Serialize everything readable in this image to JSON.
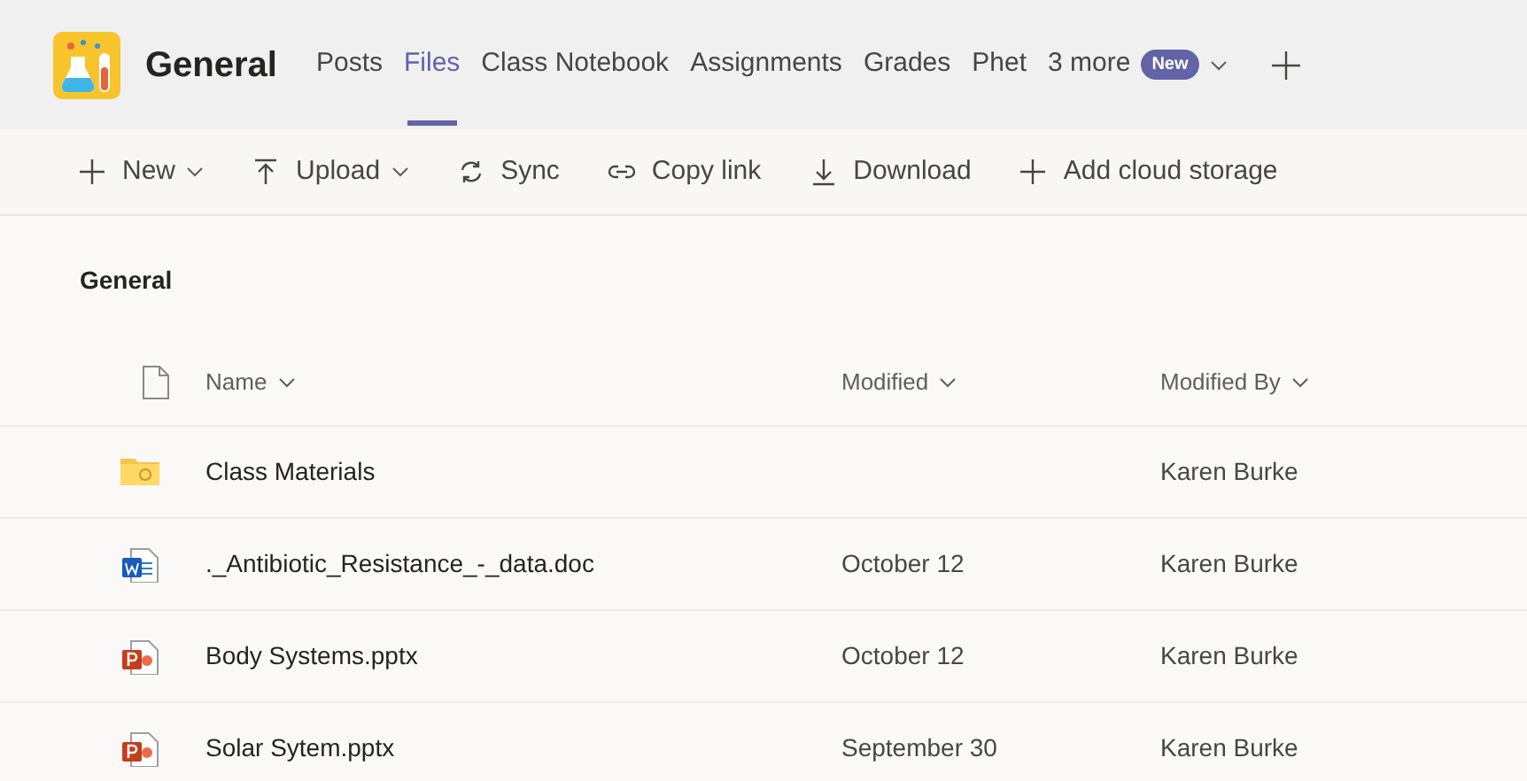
{
  "channel": {
    "name": "General"
  },
  "tabs": [
    {
      "label": "Posts",
      "selected": false
    },
    {
      "label": "Files",
      "selected": true
    },
    {
      "label": "Class Notebook",
      "selected": false
    },
    {
      "label": "Assignments",
      "selected": false
    },
    {
      "label": "Grades",
      "selected": false
    },
    {
      "label": "Phet",
      "selected": false
    }
  ],
  "more_tabs": {
    "label": "3 more",
    "badge": "New"
  },
  "toolbar": [
    {
      "kind": "plus",
      "label": "New",
      "dropdown": true
    },
    {
      "kind": "upload",
      "label": "Upload",
      "dropdown": true
    },
    {
      "kind": "sync",
      "label": "Sync",
      "dropdown": false
    },
    {
      "kind": "link",
      "label": "Copy link",
      "dropdown": false
    },
    {
      "kind": "download",
      "label": "Download",
      "dropdown": false
    },
    {
      "kind": "plus",
      "label": "Add cloud storage",
      "dropdown": false
    }
  ],
  "breadcrumb": "General",
  "table": {
    "columns": [
      "Name",
      "Modified",
      "Modified By"
    ],
    "rows": [
      {
        "kind": "folder",
        "name": "Class Materials",
        "modified": "",
        "modified_by": "Karen Burke"
      },
      {
        "kind": "word",
        "name": "._Antibiotic_Resistance_-_data.doc",
        "modified": "October 12",
        "modified_by": "Karen Burke"
      },
      {
        "kind": "powerpoint",
        "name": "Body Systems.pptx",
        "modified": "October 12",
        "modified_by": "Karen Burke"
      },
      {
        "kind": "powerpoint",
        "name": "Solar Sytem.pptx",
        "modified": "September 30",
        "modified_by": "Karen Burke"
      }
    ]
  }
}
